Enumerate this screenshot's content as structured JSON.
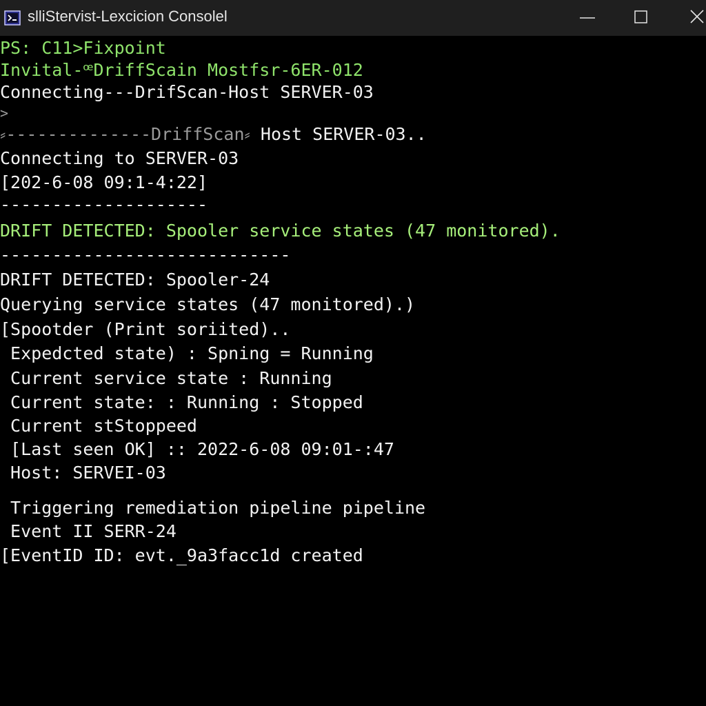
{
  "window": {
    "title": "slliStervist-Lexcicion Consolel",
    "icon": "terminal-app-icon",
    "controls": {
      "minimize_icon": "minimize-icon",
      "maximize_icon": "maximize-icon",
      "close_icon": "close-icon"
    }
  },
  "colors": {
    "background": "#000000",
    "titlebar": "#1f1f1f",
    "text": "#f2f2f2",
    "green": "#8fe36b"
  },
  "terminal": {
    "lines": {
      "l01": "PS: C11>Fixpoint",
      "l02": "Invital-ꟹDriffScain Mostfsr-6ER-012",
      "l03": "Connecting---DrifScan-Host SERVER-03",
      "l04": ">",
      "l05a": "⸗--------------DriffScan⸗",
      "l05b": " Host SERVER-03..",
      "l06": "Connecting to SERVER-03",
      "l07": "[202-6-08 09:1-4:22]",
      "l08": "--------------------",
      "l09": "DRIFT DETECTED: Spooler service states (47 monitored).",
      "l10": "----------------------------",
      "l11": "DRIFT DETECTED: Spooler-24",
      "l12": "Querying service states (47 monitored).)",
      "l13": "[Spootder (Print soriited)..",
      "l14": " Expedcted state) : Spning = Running",
      "l15": " Current service state : Running",
      "l16": " Current state: : Running : Stopped",
      "l17": " Current stStoppeed",
      "l18": " [Last seen OK] :: 2022-6-08 09:01-:47",
      "l19": " Host: SERVEI-03",
      "l20": " Triggering remediation pipeline pipeline",
      "l21": " Event II SERR-24",
      "l22": "[EventID ID: evt._9a3facc1d created"
    }
  }
}
